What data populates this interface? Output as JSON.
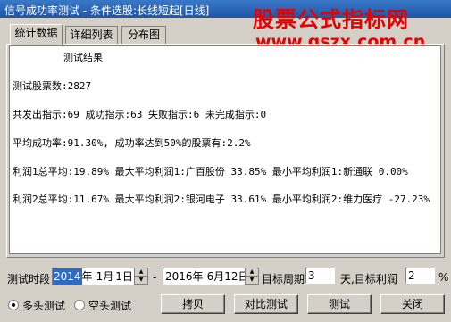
{
  "window": {
    "title": "信号成功率测试 - 条件选股:长线短起[日线]"
  },
  "watermark": {
    "title": "股票公式指标网",
    "url": "www.gszx.com.cn",
    "color": "#e60000"
  },
  "tabs": [
    {
      "label": "统计数据",
      "active": true
    },
    {
      "label": "详细列表"
    },
    {
      "label": "分布图"
    }
  ],
  "results": {
    "heading": "测试结果",
    "lines": [
      "测试股票数:2827",
      "共发出指示:69 成功指示:63 失败指示:6 未完成指示:0",
      "平均成功率:91.30%, 成功率达到50%的股票有:2.2%",
      "利润1总平均:19.89% 最大平均利润1:广百股份 33.85% 最小平均利润1:新通联 0.00%",
      "利润2总平均:11.67% 最大平均利润2:银河电子 33.61% 最小平均利润2:维力医疗 -27.23%"
    ]
  },
  "controls": {
    "period_label": "测试时段",
    "start": {
      "year": "2014",
      "year_unit": "年",
      "month": " 1",
      "month_unit": "月",
      "day": " 1",
      "day_unit": "日"
    },
    "dash": "-",
    "end": {
      "year": "2016",
      "year_unit": "年",
      "month": " 6",
      "month_unit": "月",
      "day": "12",
      "day_unit": "日"
    },
    "target_period_label": "目标周期",
    "target_period_value": "3",
    "day_label": "天,目标利润",
    "target_profit_value": "2",
    "percent": "%"
  },
  "mode": {
    "long_label": "多头测试",
    "short_label": "空头测试",
    "selected": "long"
  },
  "buttons": {
    "copy": "拷贝",
    "compare": "对比测试",
    "test": "测试",
    "close": "关闭"
  },
  "colors": {
    "titlebar": "#1f55a8",
    "selection": "#316ac5",
    "face": "#d4d0c8"
  }
}
